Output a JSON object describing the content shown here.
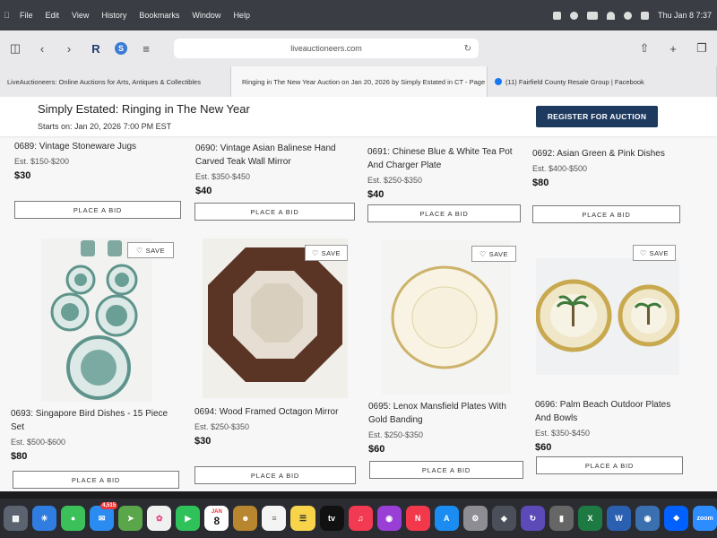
{
  "menubar": {
    "items": [
      "File",
      "Edit",
      "View",
      "History",
      "Bookmarks",
      "Window",
      "Help"
    ],
    "clock": "Thu Jan 8  7:37"
  },
  "browser": {
    "url": "liveauctioneers.com",
    "tabs": [
      "LiveAuctioneers: Online Auctions for Arts, Antiques & Collectibles",
      "Ringing in The New Year Auction on Jan 20, 2026 by Simply Estated in CT - Page 5",
      "(11) Fairfield County Resale Group | Facebook"
    ]
  },
  "auction": {
    "title": "Simply Estated: Ringing in The New Year",
    "starts": "Starts on: Jan 20, 2026 7:00 PM EST",
    "register_label": "REGISTER FOR AUCTION"
  },
  "lots_top": [
    {
      "name": "0689: Vintage Stoneware Jugs",
      "est": "Est. $150-$200",
      "price": "$30",
      "bid": "PLACE A BID"
    },
    {
      "name": "0690: Vintage Asian Balinese Hand Carved Teak Wall Mirror",
      "est": "Est. $350-$450",
      "price": "$40",
      "bid": "PLACE A BID"
    },
    {
      "name": "0691: Chinese Blue & White Tea Pot And Charger Plate",
      "est": "Est. $250-$350",
      "price": "$40",
      "bid": "PLACE A BID"
    },
    {
      "name": "0692: Asian Green & Pink Dishes",
      "est": "Est. $400-$500",
      "price": "$80",
      "bid": "PLACE A BID"
    }
  ],
  "lots_bottom": [
    {
      "name": "0693: Singapore Bird Dishes - 15 Piece Set",
      "est": "Est. $500-$600",
      "price": "$80",
      "bid": "PLACE A BID",
      "save": "SAVE"
    },
    {
      "name": "0694: Wood Framed Octagon Mirror",
      "est": "Est. $250-$350",
      "price": "$30",
      "bid": "PLACE A BID",
      "save": "SAVE"
    },
    {
      "name": "0695: Lenox Mansfield Plates With Gold Banding",
      "est": "Est. $250-$350",
      "price": "$60",
      "bid": "PLACE A BID",
      "save": "SAVE"
    },
    {
      "name": "0696: Palm Beach Outdoor Plates And Bowls",
      "est": "Est. $350-$450",
      "price": "$60",
      "bid": "PLACE A BID",
      "save": "SAVE"
    }
  ],
  "dock": {
    "mail_badge": "4,515",
    "calendar_month": "JAN",
    "calendar_day": "8"
  },
  "colors": {
    "register_button": "#1e3a5f",
    "page_background": "#f7f7f7"
  }
}
